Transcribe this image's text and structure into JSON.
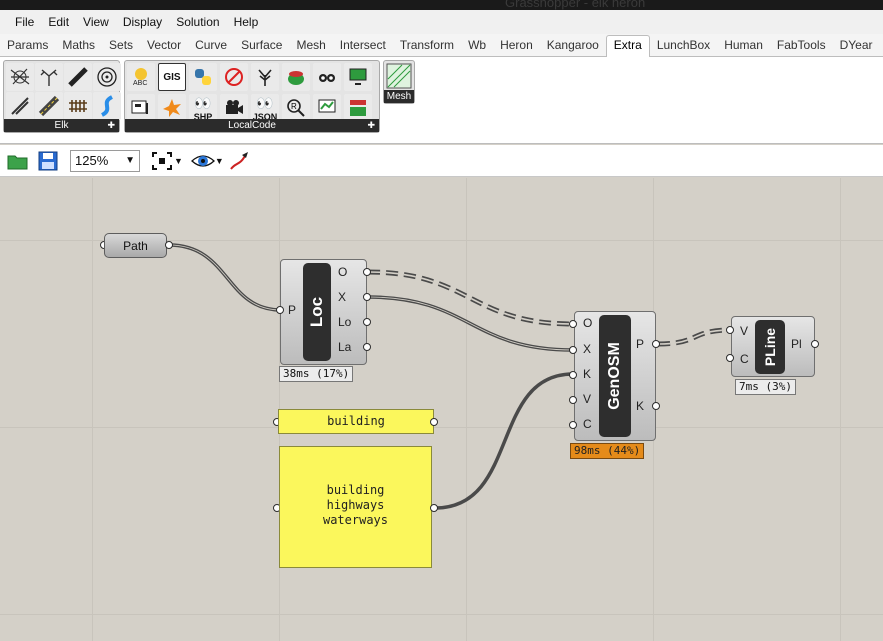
{
  "window": {
    "title": "Grasshopper - elk heron"
  },
  "menu": [
    "File",
    "Edit",
    "View",
    "Display",
    "Solution",
    "Help"
  ],
  "tabs": [
    "Params",
    "Maths",
    "Sets",
    "Vector",
    "Curve",
    "Surface",
    "Mesh",
    "Intersect",
    "Transform",
    "Wb",
    "Heron",
    "Kangaroo",
    "Extra",
    "LunchBox",
    "Human",
    "FabTools",
    "DYear"
  ],
  "active_tab": "Extra",
  "ribbon": {
    "elk_label": "Elk",
    "localcode_label": "LocalCode",
    "mesh_label": "Mesh",
    "localcode_texts": {
      "gis": "GIS",
      "shp": "SHP",
      "json": "JSON"
    }
  },
  "toolbar": {
    "zoom": "125%"
  },
  "canvas": {
    "path_param": {
      "label": "Path"
    },
    "loc": {
      "name": "Loc",
      "inputs": [
        "P"
      ],
      "outputs": [
        "O",
        "X",
        "Lo",
        "La"
      ],
      "timing": "38ms (17%)"
    },
    "genosm": {
      "name": "GenOSM",
      "inputs": [
        "O",
        "X",
        "K",
        "V",
        "C"
      ],
      "outputs": [
        "P",
        "K"
      ],
      "timing": "98ms (44%)"
    },
    "pline": {
      "name": "PLine",
      "inputs": [
        "V",
        "C"
      ],
      "outputs": [
        "Pl"
      ],
      "timing": "7ms (3%)"
    },
    "panel1": {
      "text": "building"
    },
    "panel2": {
      "lines": [
        "building",
        "highways",
        "waterways"
      ]
    }
  },
  "colors": {
    "canvas": "#d4d0c8",
    "panel": "#fbf75c",
    "timing_warn": "#e58b1a"
  }
}
